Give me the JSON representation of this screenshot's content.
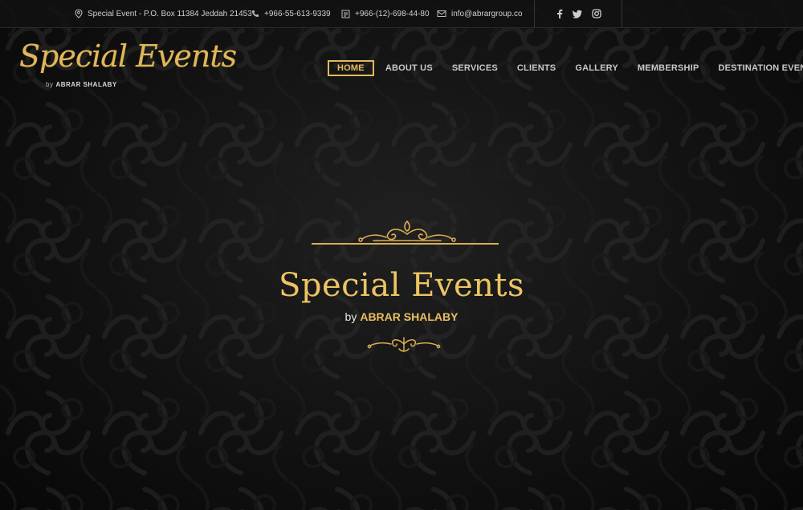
{
  "topbar": {
    "address": "Special Event - P.O. Box 11384 Jeddah 21453",
    "mobile": "+966-55-613-9339",
    "fax": "+966-(12)-698-44-80",
    "email": "info@abrargroup.co",
    "social_icons": [
      "facebook-icon",
      "twitter-icon",
      "instagram-icon"
    ]
  },
  "logo": {
    "script": "Special Events",
    "by": "by",
    "name": "ABRAR SHALABY"
  },
  "nav": {
    "items": [
      {
        "label": "HOME",
        "active": true
      },
      {
        "label": "ABOUT US"
      },
      {
        "label": "SERVICES"
      },
      {
        "label": "CLIENTS"
      },
      {
        "label": "GALLERY"
      },
      {
        "label": "MEMBERSHIP"
      },
      {
        "label": "DESTINATION EVENTS"
      }
    ]
  },
  "hero": {
    "title": "Special Events",
    "by": "by",
    "name": "ABRAR SHALABY"
  },
  "colors": {
    "gold": "#e3b95b",
    "background": "#111111",
    "text": "#c9c9c9"
  }
}
